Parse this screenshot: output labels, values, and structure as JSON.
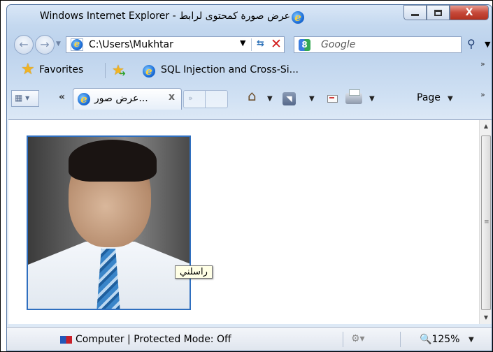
{
  "window": {
    "title": "عرض صورة كمحتوى لرابط - Windows Internet Explorer",
    "controls": {
      "minimize": "–",
      "maximize": "□",
      "close": "X"
    }
  },
  "address_bar": {
    "url": "C:\\Users\\Mukhtar",
    "search_placeholder": "Google"
  },
  "favorites_bar": {
    "favorites_label": "Favorites",
    "link_label": "SQL Injection and Cross-Si...",
    "overflow": "»"
  },
  "tabs": {
    "list_label": "«",
    "active_tab_label": "...عرض صور",
    "close_tab": "x",
    "new_tab_chevron": "»"
  },
  "command_bar": {
    "page_label": "Page",
    "overflow": "»"
  },
  "content": {
    "image_tooltip": "راسلني"
  },
  "status_bar": {
    "zone_text": "Computer | Protected Mode: Off",
    "zoom": "125%"
  }
}
